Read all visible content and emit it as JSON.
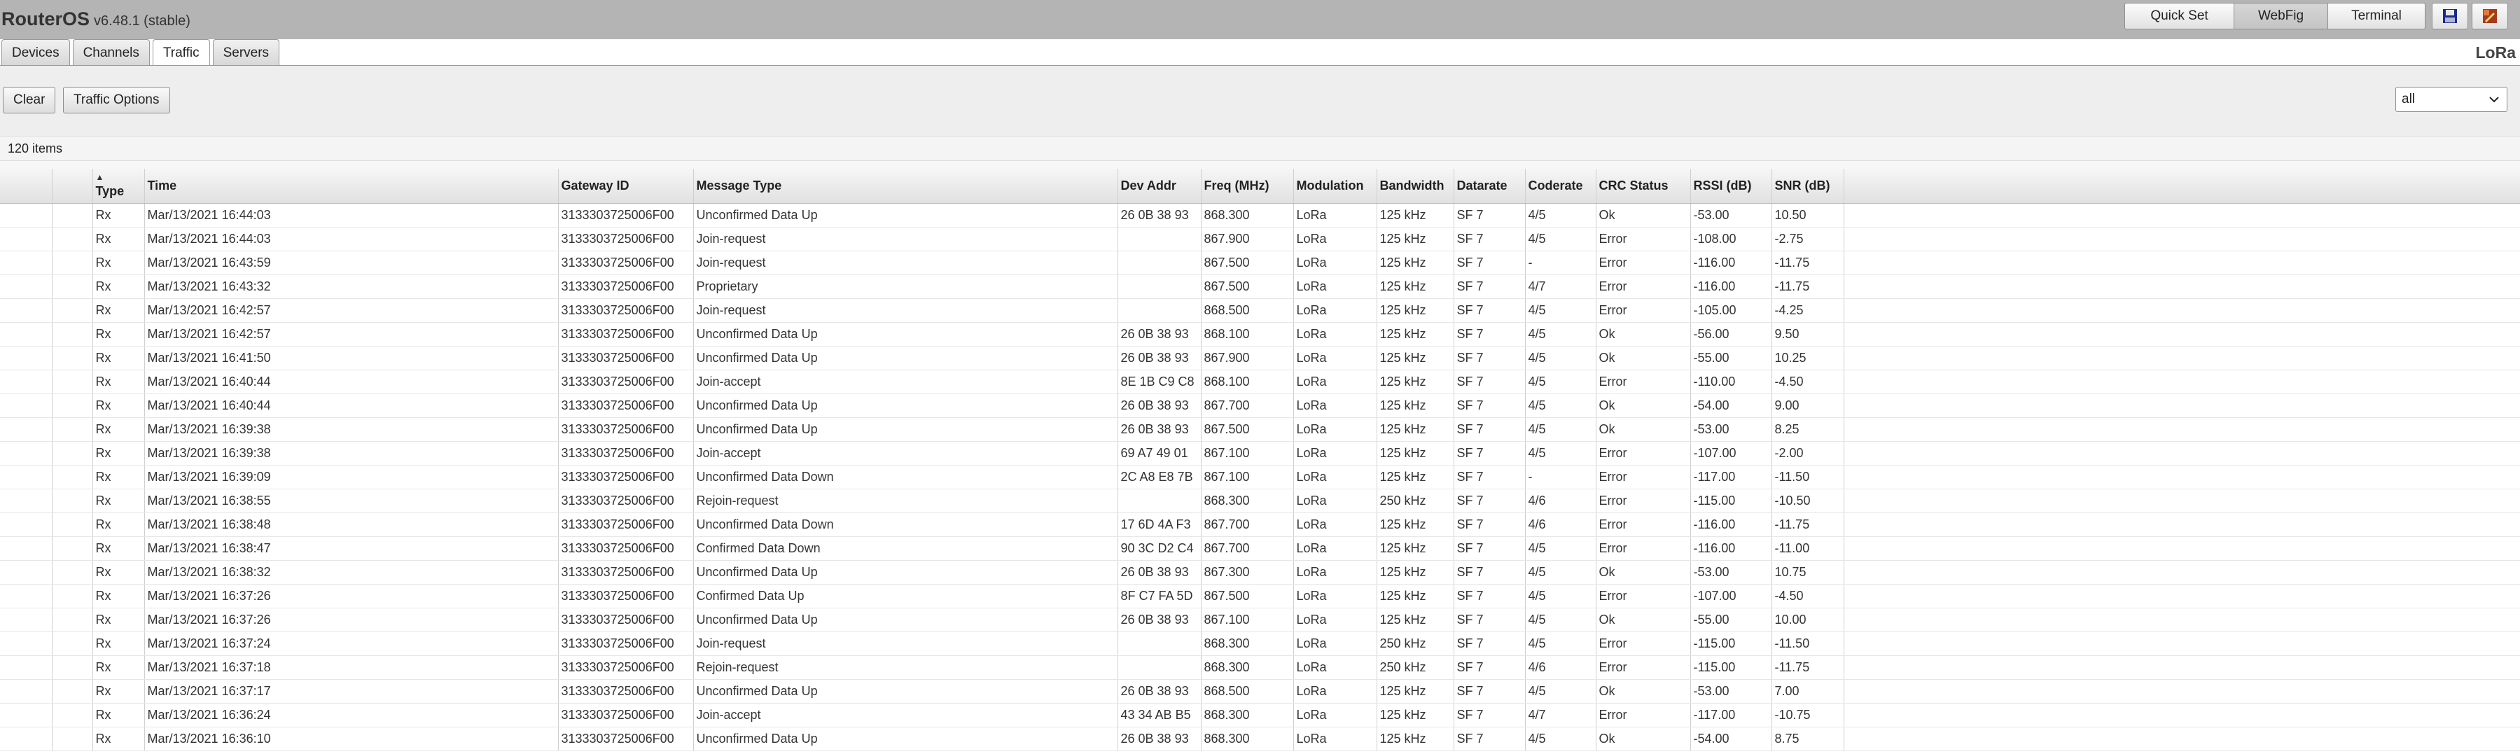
{
  "app": {
    "brand": "RouterOS",
    "version": "v6.48.1 (stable)",
    "modes": [
      "Quick Set",
      "WebFig",
      "Terminal"
    ],
    "active_mode": "WebFig",
    "package_label": "LoRa"
  },
  "tabs": [
    {
      "label": "Devices",
      "active": false
    },
    {
      "label": "Channels",
      "active": false
    },
    {
      "label": "Traffic",
      "active": true
    },
    {
      "label": "Servers",
      "active": false
    }
  ],
  "toolbar": {
    "clear_label": "Clear",
    "options_label": "Traffic Options",
    "filter_value": "all"
  },
  "items_count": "120 items",
  "icons": {
    "save": "save-icon",
    "design": "design-icon",
    "dropdown": "chevron-down-icon",
    "sort": "sort-asc-icon"
  },
  "colors": {
    "header_bg": "#b4b4b4",
    "toolbar_bg": "#eeeeee"
  },
  "table": {
    "sort_indicator": "▲",
    "columns": [
      "Type",
      "Time",
      "Gateway ID",
      "Message Type",
      "Dev Addr",
      "Freq (MHz)",
      "Modulation",
      "Bandwidth",
      "Datarate",
      "Coderate",
      "CRC Status",
      "RSSI (dB)",
      "SNR (dB)"
    ],
    "rows": [
      [
        "Rx",
        "Mar/13/2021 16:44:03",
        "3133303725006F00",
        "Unconfirmed Data Up",
        "26 0B 38 93",
        "868.300",
        "LoRa",
        "125 kHz",
        "SF 7",
        "4/5",
        "Ok",
        "-53.00",
        "10.50"
      ],
      [
        "Rx",
        "Mar/13/2021 16:44:03",
        "3133303725006F00",
        "Join-request",
        "",
        "867.900",
        "LoRa",
        "125 kHz",
        "SF 7",
        "4/5",
        "Error",
        "-108.00",
        "-2.75"
      ],
      [
        "Rx",
        "Mar/13/2021 16:43:59",
        "3133303725006F00",
        "Join-request",
        "",
        "867.500",
        "LoRa",
        "125 kHz",
        "SF 7",
        "-",
        "Error",
        "-116.00",
        "-11.75"
      ],
      [
        "Rx",
        "Mar/13/2021 16:43:32",
        "3133303725006F00",
        "Proprietary",
        "",
        "867.500",
        "LoRa",
        "125 kHz",
        "SF 7",
        "4/7",
        "Error",
        "-116.00",
        "-11.75"
      ],
      [
        "Rx",
        "Mar/13/2021 16:42:57",
        "3133303725006F00",
        "Join-request",
        "",
        "868.500",
        "LoRa",
        "125 kHz",
        "SF 7",
        "4/5",
        "Error",
        "-105.00",
        "-4.25"
      ],
      [
        "Rx",
        "Mar/13/2021 16:42:57",
        "3133303725006F00",
        "Unconfirmed Data Up",
        "26 0B 38 93",
        "868.100",
        "LoRa",
        "125 kHz",
        "SF 7",
        "4/5",
        "Ok",
        "-56.00",
        "9.50"
      ],
      [
        "Rx",
        "Mar/13/2021 16:41:50",
        "3133303725006F00",
        "Unconfirmed Data Up",
        "26 0B 38 93",
        "867.900",
        "LoRa",
        "125 kHz",
        "SF 7",
        "4/5",
        "Ok",
        "-55.00",
        "10.25"
      ],
      [
        "Rx",
        "Mar/13/2021 16:40:44",
        "3133303725006F00",
        "Join-accept",
        "8E 1B C9 C8",
        "868.100",
        "LoRa",
        "125 kHz",
        "SF 7",
        "4/5",
        "Error",
        "-110.00",
        "-4.50"
      ],
      [
        "Rx",
        "Mar/13/2021 16:40:44",
        "3133303725006F00",
        "Unconfirmed Data Up",
        "26 0B 38 93",
        "867.700",
        "LoRa",
        "125 kHz",
        "SF 7",
        "4/5",
        "Ok",
        "-54.00",
        "9.00"
      ],
      [
        "Rx",
        "Mar/13/2021 16:39:38",
        "3133303725006F00",
        "Unconfirmed Data Up",
        "26 0B 38 93",
        "867.500",
        "LoRa",
        "125 kHz",
        "SF 7",
        "4/5",
        "Ok",
        "-53.00",
        "8.25"
      ],
      [
        "Rx",
        "Mar/13/2021 16:39:38",
        "3133303725006F00",
        "Join-accept",
        "69 A7 49 01",
        "867.100",
        "LoRa",
        "125 kHz",
        "SF 7",
        "4/5",
        "Error",
        "-107.00",
        "-2.00"
      ],
      [
        "Rx",
        "Mar/13/2021 16:39:09",
        "3133303725006F00",
        "Unconfirmed Data Down",
        "2C A8 E8 7B",
        "867.100",
        "LoRa",
        "125 kHz",
        "SF 7",
        "-",
        "Error",
        "-117.00",
        "-11.50"
      ],
      [
        "Rx",
        "Mar/13/2021 16:38:55",
        "3133303725006F00",
        "Rejoin-request",
        "",
        "868.300",
        "LoRa",
        "250 kHz",
        "SF 7",
        "4/6",
        "Error",
        "-115.00",
        "-10.50"
      ],
      [
        "Rx",
        "Mar/13/2021 16:38:48",
        "3133303725006F00",
        "Unconfirmed Data Down",
        "17 6D 4A F3",
        "867.700",
        "LoRa",
        "125 kHz",
        "SF 7",
        "4/6",
        "Error",
        "-116.00",
        "-11.75"
      ],
      [
        "Rx",
        "Mar/13/2021 16:38:47",
        "3133303725006F00",
        "Confirmed Data Down",
        "90 3C D2 C4",
        "867.700",
        "LoRa",
        "125 kHz",
        "SF 7",
        "4/5",
        "Error",
        "-116.00",
        "-11.00"
      ],
      [
        "Rx",
        "Mar/13/2021 16:38:32",
        "3133303725006F00",
        "Unconfirmed Data Up",
        "26 0B 38 93",
        "867.300",
        "LoRa",
        "125 kHz",
        "SF 7",
        "4/5",
        "Ok",
        "-53.00",
        "10.75"
      ],
      [
        "Rx",
        "Mar/13/2021 16:37:26",
        "3133303725006F00",
        "Confirmed Data Up",
        "8F C7 FA 5D",
        "867.500",
        "LoRa",
        "125 kHz",
        "SF 7",
        "4/5",
        "Error",
        "-107.00",
        "-4.50"
      ],
      [
        "Rx",
        "Mar/13/2021 16:37:26",
        "3133303725006F00",
        "Unconfirmed Data Up",
        "26 0B 38 93",
        "867.100",
        "LoRa",
        "125 kHz",
        "SF 7",
        "4/5",
        "Ok",
        "-55.00",
        "10.00"
      ],
      [
        "Rx",
        "Mar/13/2021 16:37:24",
        "3133303725006F00",
        "Join-request",
        "",
        "868.300",
        "LoRa",
        "250 kHz",
        "SF 7",
        "4/5",
        "Error",
        "-115.00",
        "-11.50"
      ],
      [
        "Rx",
        "Mar/13/2021 16:37:18",
        "3133303725006F00",
        "Rejoin-request",
        "",
        "868.300",
        "LoRa",
        "250 kHz",
        "SF 7",
        "4/6",
        "Error",
        "-115.00",
        "-11.75"
      ],
      [
        "Rx",
        "Mar/13/2021 16:37:17",
        "3133303725006F00",
        "Unconfirmed Data Up",
        "26 0B 38 93",
        "868.500",
        "LoRa",
        "125 kHz",
        "SF 7",
        "4/5",
        "Ok",
        "-53.00",
        "7.00"
      ],
      [
        "Rx",
        "Mar/13/2021 16:36:24",
        "3133303725006F00",
        "Join-accept",
        "43 34 AB B5",
        "868.300",
        "LoRa",
        "125 kHz",
        "SF 7",
        "4/7",
        "Error",
        "-117.00",
        "-10.75"
      ],
      [
        "Rx",
        "Mar/13/2021 16:36:10",
        "3133303725006F00",
        "Unconfirmed Data Up",
        "26 0B 38 93",
        "868.300",
        "LoRa",
        "125 kHz",
        "SF 7",
        "4/5",
        "Ok",
        "-54.00",
        "8.75"
      ]
    ]
  }
}
